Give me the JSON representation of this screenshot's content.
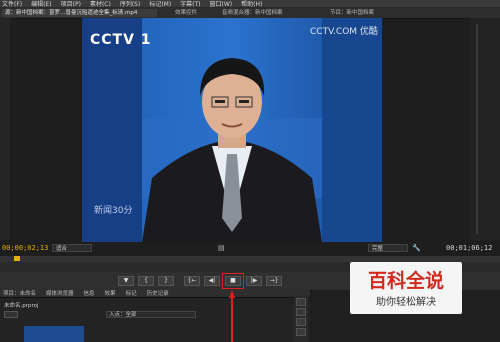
{
  "menu": {
    "items": [
      "文件(F)",
      "编辑(E)",
      "项目(P)",
      "素材(C)",
      "序列(S)",
      "标记(M)",
      "字幕(T)",
      "窗口(W)",
      "帮助(H)"
    ]
  },
  "tabs": {
    "source": "源：新中国档案：普罗…普曼沉船遗迹全集_标清.mp4",
    "effect_controls": "效果控件",
    "audio_mixer": "音频混合器：新中国档案",
    "program": "节目：新中国档案"
  },
  "video": {
    "top_logo": "CCTV 1",
    "top_right_logo": "CCTV.COM 优酷",
    "lower_logo": "新闻30分"
  },
  "viewer": {
    "timecode_current": "00;00;02;13",
    "timecode_duration": "00;01;06;12",
    "fit_left": "适合",
    "fit_right": "完整"
  },
  "transport": {
    "buttons": [
      "▼",
      "{",
      "}",
      "{←",
      "◀|",
      "■",
      "|▶",
      "→}"
    ]
  },
  "bottom_panel": {
    "tabs": [
      "项目：未命名",
      "媒体浏览器",
      "信息",
      "效果",
      "标记",
      "历史记录"
    ],
    "project_file": "未命名.prproj",
    "entry_label": "入点：全部"
  },
  "watermark": {
    "title": "百科全说",
    "subtitle": "助你轻松解决"
  }
}
